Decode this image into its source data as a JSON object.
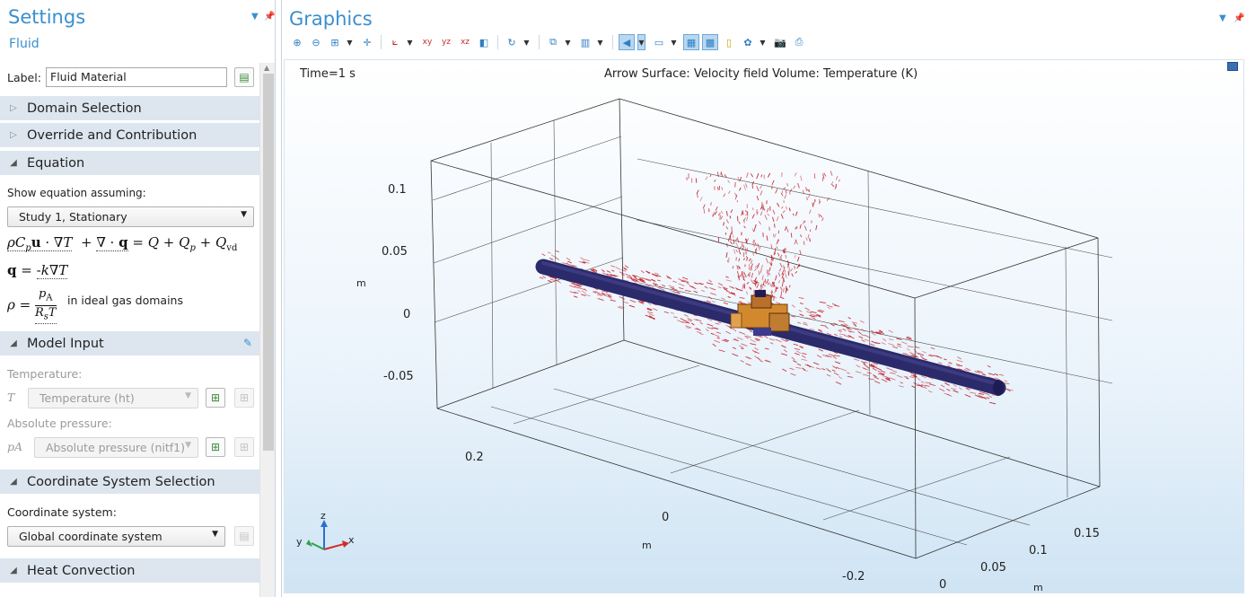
{
  "settings": {
    "title": "Settings",
    "subtitle": "Fluid",
    "label_field": {
      "label": "Label:",
      "value": "Fluid Material"
    },
    "sections": {
      "domain_selection": "Domain Selection",
      "override": "Override and Contribution",
      "equation": "Equation",
      "model_input": "Model Input",
      "coord_sys": "Coordinate System Selection",
      "heat_convection": "Heat Convection"
    },
    "equation": {
      "show_assuming_label": "Show equation assuming:",
      "study_value": "Study 1, Stationary",
      "ideal_gas_text": "in ideal gas domains"
    },
    "model_input": {
      "temperature_label": "Temperature:",
      "temperature_symbol": "T",
      "temperature_value": "Temperature (ht)",
      "pressure_label": "Absolute pressure:",
      "pressure_symbol": "pA",
      "pressure_value": "Absolute pressure (nitf1)"
    },
    "coordinate_system": {
      "label": "Coordinate system:",
      "value": "Global coordinate system"
    }
  },
  "graphics": {
    "title": "Graphics",
    "time_label": "Time=1 s",
    "plot_title": "Arrow Surface: Velocity field  Volume: Temperature (K)",
    "z_axis": {
      "ticks": [
        "0.1",
        "0.05",
        "0",
        "-0.05"
      ],
      "unit": "m"
    },
    "x_axis": {
      "ticks": [
        "0.2",
        "0",
        "-0.2"
      ],
      "unit": "m"
    },
    "y_axis": {
      "ticks": [
        "0.15",
        "0.1",
        "0.05",
        "0"
      ],
      "unit": "m"
    },
    "triad": {
      "x": "x",
      "y": "y",
      "z": "z"
    }
  },
  "colors": {
    "accent": "#3a8fce",
    "section_bg": "#dde6ef",
    "pipe": "#2b2a6b",
    "arrows": "#c0141e",
    "valve": "#d2892e"
  }
}
